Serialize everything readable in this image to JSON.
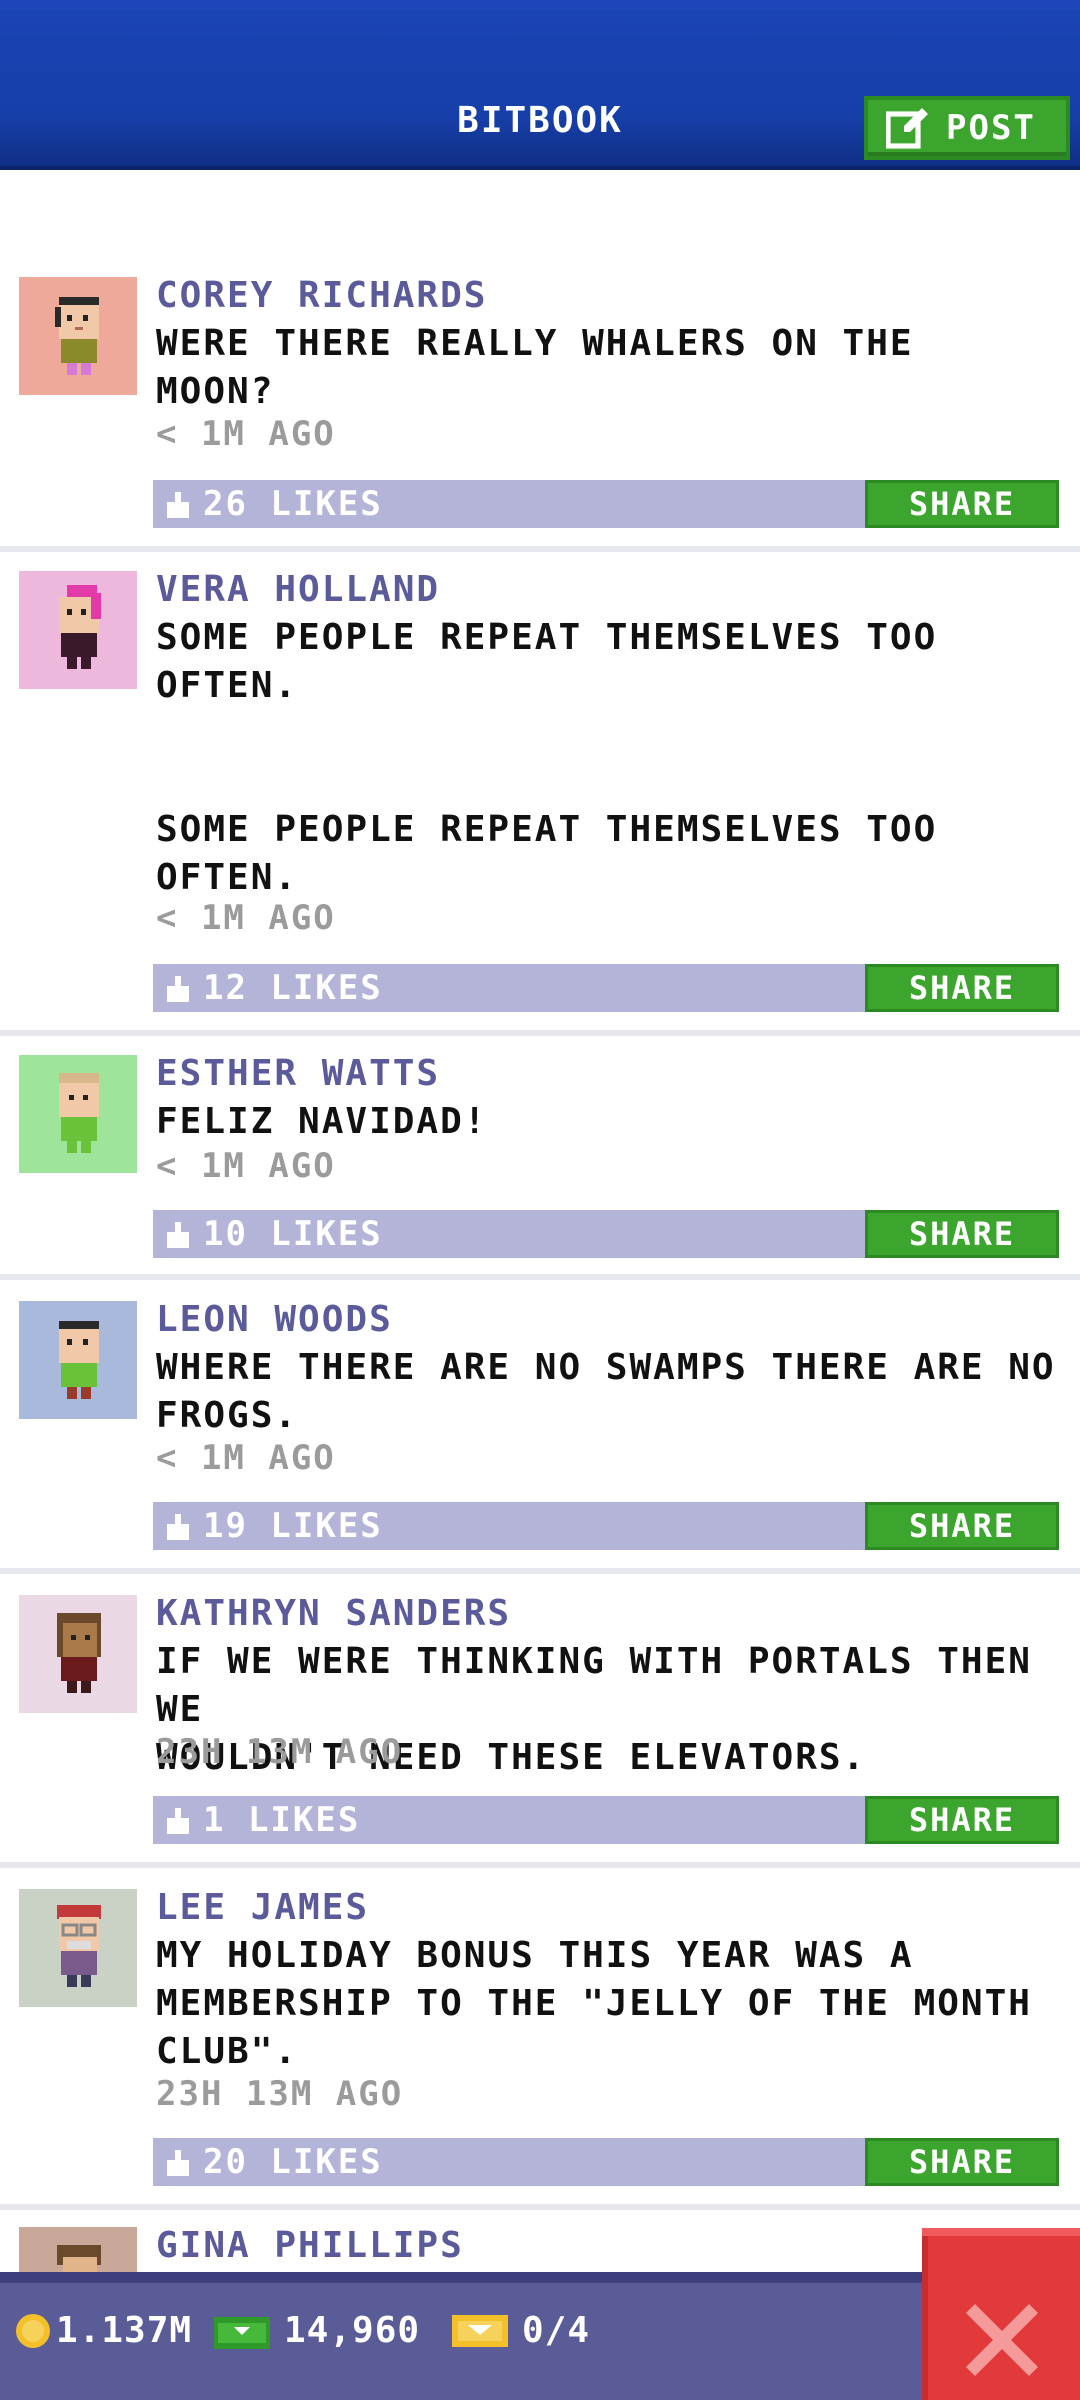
{
  "header": {
    "title": "BITBOOK",
    "post_label": "POST"
  },
  "posts": [
    {
      "author": "COREY RICHARDS",
      "text": "WERE THERE REALLY WHALERS ON THE\nMOON?",
      "time": "< 1M AGO",
      "likes": "26 LIKES",
      "share": "SHARE"
    },
    {
      "author": "VERA HOLLAND",
      "text": "SOME PEOPLE REPEAT THEMSELVES TOO\nOFTEN.\n\n\nSOME PEOPLE REPEAT THEMSELVES TOO\nOFTEN.",
      "time": "< 1M AGO",
      "likes": "12 LIKES",
      "share": "SHARE"
    },
    {
      "author": "ESTHER WATTS",
      "text": "FELIZ NAVIDAD!",
      "time": "< 1M AGO",
      "likes": "10 LIKES",
      "share": "SHARE"
    },
    {
      "author": "LEON WOODS",
      "text": "WHERE THERE ARE NO SWAMPS THERE ARE NO\nFROGS.",
      "time": "< 1M AGO",
      "likes": "19 LIKES",
      "share": "SHARE"
    },
    {
      "author": "KATHRYN SANDERS",
      "text": "IF WE WERE THINKING WITH PORTALS THEN WE\nWOULDN'T NEED THESE ELEVATORS.",
      "time": "23H 13M AGO",
      "likes": "1 LIKES",
      "share": "SHARE"
    },
    {
      "author": "LEE JAMES",
      "text": "MY HOLIDAY BONUS THIS YEAR WAS A\nMEMBERSHIP TO THE \"JELLY OF THE MONTH\nCLUB\".",
      "time": "23H 13M AGO",
      "likes": "20 LIKES",
      "share": "SHARE"
    },
    {
      "author": "GINA PHILLIPS"
    }
  ],
  "status": {
    "coins": "1.137M",
    "bux": "14,960",
    "tickets": "0/4"
  },
  "colors": {
    "header_blue": "#173fa9",
    "accent_green": "#3ca52e",
    "likes_bar": "#b3b4d7",
    "author_purple": "#5b5a9a",
    "bottom_bar": "#5a5c98",
    "close_red": "#e23a3a"
  },
  "icons": {
    "post": "edit-icon",
    "like": "thumbs-up-icon",
    "coin": "coin-icon",
    "bux": "bux-icon",
    "ticket": "ticket-icon",
    "close": "close-icon"
  }
}
